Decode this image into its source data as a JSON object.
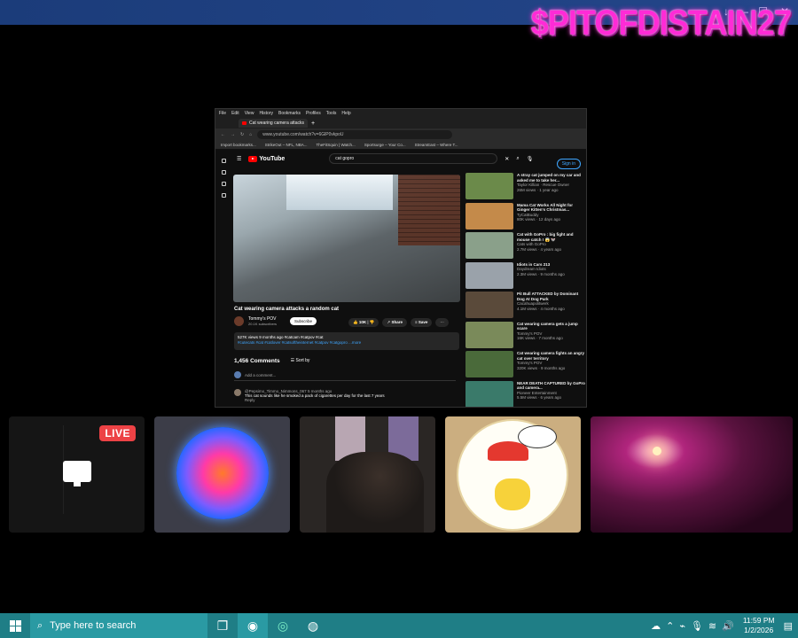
{
  "overlay": {
    "brand_text": "$PITOFDISTAIN27"
  },
  "browser": {
    "menu": [
      "File",
      "Edit",
      "View",
      "History",
      "Bookmarks",
      "Profiles",
      "Tools",
      "Help"
    ],
    "tab_title": "Cat wearing camera attacks",
    "url": "www.youtube.com/watch?v=6GlP0vkpoU",
    "bookmarks": [
      "Import bookmarks...",
      "StrikeOut – NFL, NBA...",
      "TheFitSquin | Watch...",
      "Sportsurge – Your Co...",
      "StreamEast – Where T..."
    ]
  },
  "youtube": {
    "logo": "YouTube",
    "search_query": "cat gopro",
    "sign_in": "Sign in",
    "video_title": "Cat wearing camera attacks a random cat",
    "channel": {
      "name": "Tommy's POV",
      "subs": "20.1K subscribers"
    },
    "subscribe": "Subscribe",
    "likes": "10K",
    "share": "Share",
    "save": "Save",
    "desc_line1": "527K views  9 months ago  #catcam #catpov #cat",
    "desc_line2": "#cutecats #cat #catlover #catsoftheinternet #catpov #catgopro ...more",
    "comments_count": "1,456 Comments",
    "sort_by": "Sort by",
    "add_comment": "Add a comment...",
    "comment_user": "@Pepsimo_Timmo_Nimmons_067",
    "comment_age": "5 months ago",
    "comment_text": "This cat sounds like he smoked a pack of cigarettes per day for the last 7 years",
    "reply": "Reply",
    "recs": [
      {
        "title": "A stray cat jumped on my car and asked me to take her...",
        "channel": "Taylor Killian · Rescue Owner",
        "meta": "26M views · 1 year ago",
        "color": "#6b8a4a"
      },
      {
        "title": "Mama Cat Works All Night for Ginger Kitten's Christmas...",
        "channel": "TyCatBuddy",
        "meta": "80K views · 12 days ago",
        "color": "#c48a4a"
      },
      {
        "title": "Cat with GoPro : big fight and mouse catch ! 😱 🐭",
        "channel": "Cats with GoPro",
        "meta": "2.7M views · 4 years ago",
        "color": "#8aa08a"
      },
      {
        "title": "Idiots in Cars 213",
        "channel": "Daydream Idiots",
        "meta": "2.3M views · 9 months ago",
        "color": "#9aa2aa"
      },
      {
        "title": "Pit Bull ATTACKED by Dominant Dog At Dog Park",
        "channel": "Cacahuapolitwerk",
        "meta": "4.1M views · 4 months ago",
        "color": "#5a4a3a"
      },
      {
        "title": "Cat wearing camera gets a jump scare",
        "channel": "Tommy's POV",
        "meta": "16K views · 7 months ago",
        "color": "#7a8a5a"
      },
      {
        "title": "Cat wearing camera fights an angry cat over territory",
        "channel": "Tommy's POV",
        "meta": "320K views · 9 months ago",
        "color": "#4a6a3a"
      },
      {
        "title": "NEAR DEATH CAPTURED by GoPro and camera...",
        "channel": "Pioneer Entertainment",
        "meta": "5.5M views · 6 years ago",
        "color": "#3a7a6a"
      }
    ]
  },
  "tiles": {
    "live_badge": "LIVE"
  },
  "taskbar": {
    "search_placeholder": "Type here to search",
    "time": "11:59 PM",
    "date": "1/2/2026"
  }
}
